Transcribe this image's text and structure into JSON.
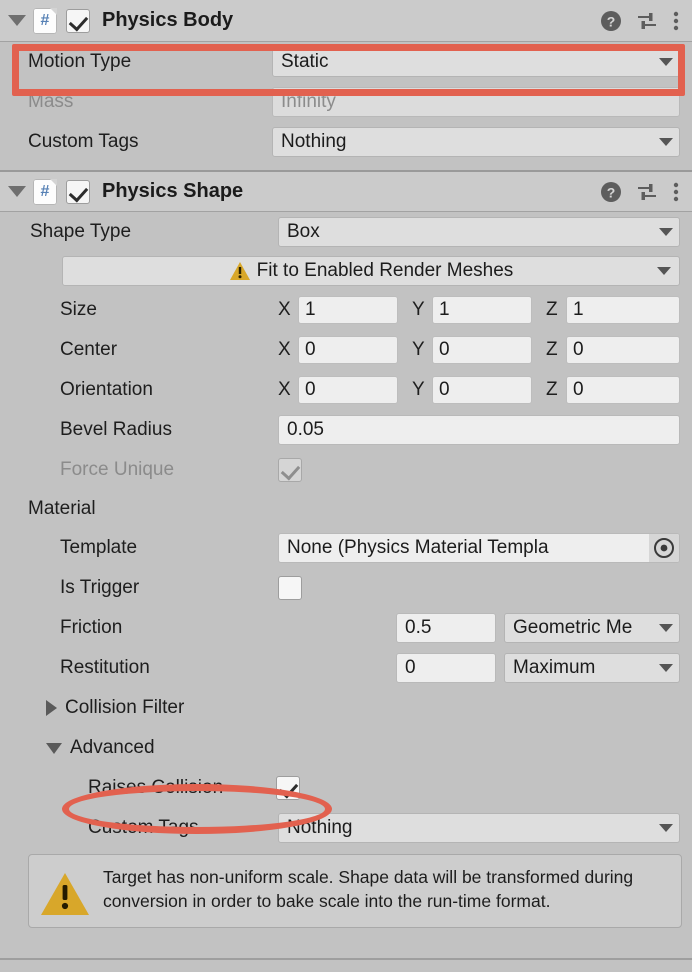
{
  "theme": {
    "panel_bg": "#c2c2c2",
    "header_bg": "#cbcbcb",
    "field_bg": "#e3e3e3",
    "annotation_color": "#e2614f",
    "warning_color": "#d8a72a",
    "script_icon_accent": "#5781b5"
  },
  "physics_body": {
    "title": "Physics Body",
    "enabled": true,
    "expanded": true,
    "icons": {
      "foldout": "triangle-down-icon",
      "script": "script-hash-icon",
      "enable": "checkbox-checked-icon",
      "help": "help-icon",
      "preset": "preset-sliders-icon",
      "menu": "three-dot-menu-icon"
    },
    "rows": [
      {
        "label": "Motion Type",
        "value": "Static",
        "kind": "dropdown",
        "disabled": false
      },
      {
        "label": "Mass",
        "value": "Infinity",
        "kind": "text",
        "disabled": true
      },
      {
        "label": "Custom Tags",
        "value": "Nothing",
        "kind": "dropdown",
        "disabled": false
      }
    ]
  },
  "physics_shape": {
    "title": "Physics Shape",
    "enabled": true,
    "expanded": true,
    "shape_type": {
      "label": "Shape Type",
      "value": "Box"
    },
    "fit_button": {
      "label": "Fit to Enabled Render Meshes",
      "icon": "warning-triangle-icon"
    },
    "vectors": [
      {
        "label": "Size",
        "x": "1",
        "y": "1",
        "z": "1"
      },
      {
        "label": "Center",
        "x": "0",
        "y": "0",
        "z": "0"
      },
      {
        "label": "Orientation",
        "x": "0",
        "y": "0",
        "z": "0"
      }
    ],
    "axis_labels": {
      "x": "X",
      "y": "Y",
      "z": "Z"
    },
    "bevel_radius": {
      "label": "Bevel Radius",
      "value": "0.05"
    },
    "force_unique": {
      "label": "Force Unique",
      "checked": true,
      "disabled": true
    },
    "material_header": "Material",
    "template": {
      "label": "Template",
      "value": "None (Physics Material Templa",
      "picker_icon": "object-picker-icon"
    },
    "is_trigger": {
      "label": "Is Trigger",
      "checked": false
    },
    "friction": {
      "label": "Friction",
      "value": "0.5",
      "combine": "Geometric Me"
    },
    "restitution": {
      "label": "Restitution",
      "value": "0",
      "combine": "Maximum"
    },
    "collision_filter": {
      "label": "Collision Filter",
      "expanded": false
    },
    "advanced": {
      "label": "Advanced",
      "expanded": true
    },
    "raises_collision": {
      "label": "Raises Collision",
      "checked": true
    },
    "advanced_custom_tags": {
      "label": "Custom Tags",
      "value": "Nothing"
    },
    "help_box": {
      "icon": "warning-triangle-icon",
      "text": "Target has non-uniform scale. Shape data will be transformed during conversion in order to bake scale into the run-time format."
    }
  },
  "annotations": [
    {
      "name": "motion-type-highlight",
      "shape": "rect",
      "target": "Motion Type"
    },
    {
      "name": "raises-collision-highlight",
      "shape": "ellipse",
      "target": "Raises Collision"
    }
  ]
}
